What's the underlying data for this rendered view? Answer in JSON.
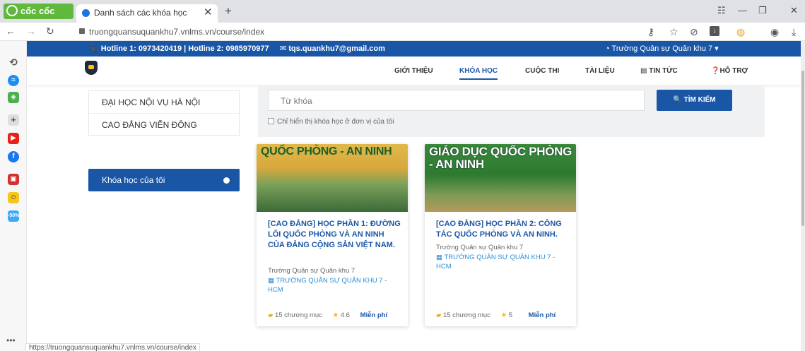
{
  "browser": {
    "brand": "cốc cốc",
    "tab_title": "Danh sách các khóa học",
    "tab_close": "✕",
    "new_tab": "+",
    "url": "truongquansuquankhu7.vnlms.vn/course/index",
    "status_url": "https://truongquansuquankhu7.vnlms.vn/course/index"
  },
  "site": {
    "hotline": "📞 Hotline 1: 0973420419 | Hotline 2: 0985970977",
    "email": "✉ tqs.quankhu7@gmail.com",
    "org_select": "Trường Quân sự Quân khu 7",
    "menu": [
      "GIỚI THIỆU",
      "KHÓA HỌC",
      "CUỘC THI",
      "TÀI LIỆU",
      "TIN TỨC",
      "HỖ TRỢ"
    ]
  },
  "categories": [
    "ĐẠI HỌC NỘI VỤ HÀ NỘI",
    "CAO ĐẲNG VIỄN ĐÔNG"
  ],
  "my_courses_label": "Khóa học của tôi",
  "search": {
    "placeholder": "Từ khóa",
    "button": "TÌM KIẾM",
    "checkbox_label": "Chỉ hiển thị khóa học ở đơn vị của tôi"
  },
  "courses": [
    {
      "cover_text": "QUỐC PHÒNG - AN NINH",
      "title": "[CAO ĐẲNG] HỌC PHẦN 1: ĐƯỜNG LỐI QUỐC PHÒNG VÀ AN NINH CỦA ĐẢNG CỘNG SẢN VIỆT NAM.",
      "school": "Trường Quân sự Quân khu 7",
      "unit": "TRƯỜNG QUÂN SỰ QUÂN KHU 7 - HCM",
      "modules": "15 chương mục",
      "rating": "4.6",
      "price": "Miễn phí"
    },
    {
      "cover_text": "GIÁO DỤC QUỐC PHÒNG - AN NINH",
      "title": "[CAO ĐẲNG] HỌC PHẦN 2: CÔNG TÁC QUỐC PHÒNG VÀ AN NINH.",
      "school": "Trường Quân sự Quân khu 7",
      "unit": "TRƯỜNG QUÂN SỰ QUÂN KHU 7 - HCM",
      "modules": "15 chương mục",
      "rating": "5",
      "price": "Miễn phí"
    }
  ],
  "colors": {
    "primary": "#1a56a6",
    "brand_green": "#60b83c",
    "accent_yellow": "#f3b62a"
  }
}
